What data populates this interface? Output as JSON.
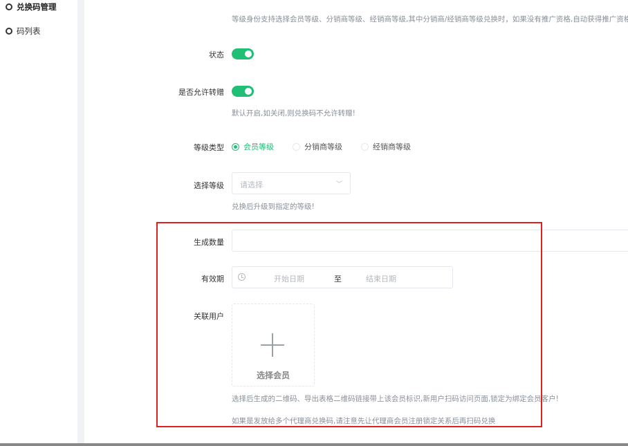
{
  "sidebar": {
    "items": [
      {
        "label": "兑换码管理",
        "active": true
      },
      {
        "label": "码列表",
        "active": false
      }
    ]
  },
  "form": {
    "level_identity_hint": "等级身份支持选择会员等级、分销商等级、经销商等级,其中分销商/经销商等级兑换时，如果没有推广资格,自动获得推广资格",
    "status": {
      "label": "状态",
      "on": true
    },
    "allow_transfer": {
      "label": "是否允许转赠",
      "on": true,
      "hint": "默认开启,如关闭,则兑换码不允许转赠!"
    },
    "level_type": {
      "label": "等级类型",
      "options": [
        "会员等级",
        "分销商等级",
        "经销商等级"
      ],
      "selected": "会员等级"
    },
    "select_level": {
      "label": "选择等级",
      "placeholder": "请选择",
      "hint": "兑换后升级到指定的等级!"
    },
    "generate_count": {
      "label": "生成数量",
      "value": ""
    },
    "validity": {
      "label": "有效期",
      "start_placeholder": "开始日期",
      "separator": "至",
      "end_placeholder": "结束日期"
    },
    "linked_user": {
      "label": "关联用户",
      "button_label": "选择会员",
      "hint1": "选择后生成的二维码、导出表格二维码链接带上该会员标识,新用户扫码访问页面,锁定为绑定会员客户!",
      "hint2": "如果是发放给多个代理商兑换码,请注意先让代理商会员注册锁定关系后再扫码兑换"
    }
  },
  "colors": {
    "accent": "#1fbf75",
    "highlight": "#e02020"
  },
  "icons": [
    "ring-icon",
    "clock-icon",
    "chevron-down-icon",
    "plus-icon"
  ]
}
